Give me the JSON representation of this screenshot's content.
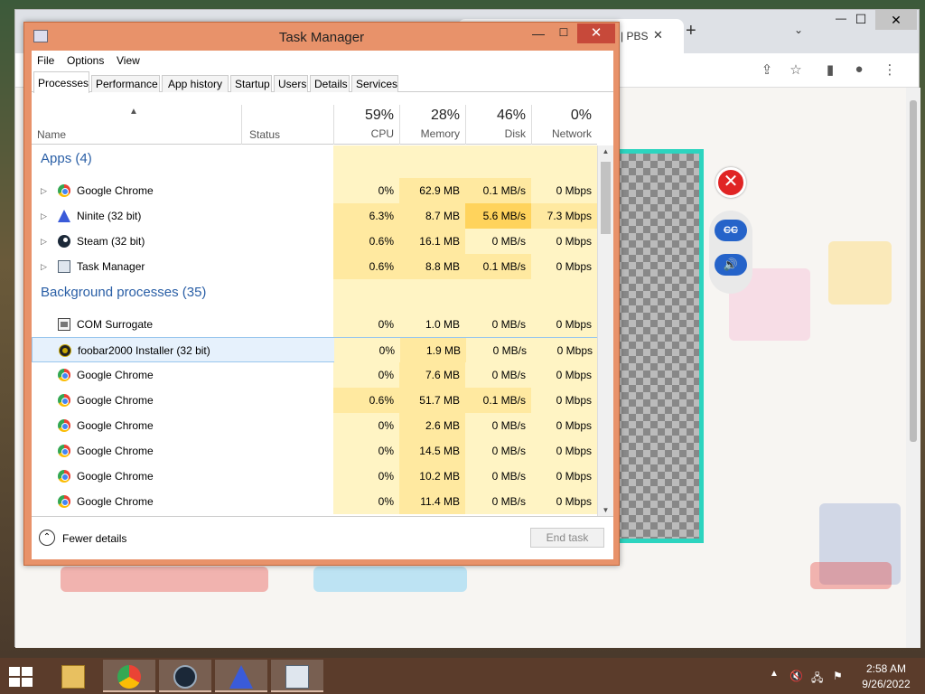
{
  "browser": {
    "tab_title": "| PBS",
    "tab_close": "✕",
    "new_tab": "+",
    "tab_search": "⌄",
    "minimize": "—",
    "maximize": "☐",
    "close": "✕",
    "icons": [
      "share-icon",
      "star-icon",
      "sidepanel-icon",
      "profile-icon",
      "menu-dots-icon"
    ]
  },
  "game": {
    "close": "✕",
    "cc": "CC",
    "sound": "🔊"
  },
  "task_manager": {
    "title": "Task Manager",
    "minimize": "—",
    "maximize": "☐",
    "close": "✕",
    "menu": [
      "File",
      "Options",
      "View"
    ],
    "tabs": [
      "Processes",
      "Performance",
      "App history",
      "Startup",
      "Users",
      "Details",
      "Services"
    ],
    "active_tab": "Processes",
    "columns": {
      "name": "Name",
      "status": "Status",
      "cpu": {
        "pct": "59%",
        "label": "CPU"
      },
      "memory": {
        "pct": "28%",
        "label": "Memory"
      },
      "disk": {
        "pct": "46%",
        "label": "Disk"
      },
      "network": {
        "pct": "0%",
        "label": "Network"
      }
    },
    "groups": {
      "apps": "Apps (4)",
      "background": "Background processes (35)"
    },
    "apps": [
      {
        "name": "Google Chrome",
        "icon": "chrome-icon",
        "cpu": "0%",
        "memory": "62.9 MB",
        "disk": "0.1 MB/s",
        "network": "0 Mbps"
      },
      {
        "name": "Ninite (32 bit)",
        "icon": "ninite-icon",
        "cpu": "6.3%",
        "memory": "8.7 MB",
        "disk": "5.6 MB/s",
        "network": "7.3 Mbps"
      },
      {
        "name": "Steam (32 bit)",
        "icon": "steam-icon",
        "cpu": "0.6%",
        "memory": "16.1 MB",
        "disk": "0 MB/s",
        "network": "0 Mbps"
      },
      {
        "name": "Task Manager",
        "icon": "task-manager-icon",
        "cpu": "0.6%",
        "memory": "8.8 MB",
        "disk": "0.1 MB/s",
        "network": "0 Mbps"
      }
    ],
    "background": [
      {
        "name": "COM Surrogate",
        "icon": "com-surrogate-icon",
        "cpu": "0%",
        "memory": "1.0 MB",
        "disk": "0 MB/s",
        "network": "0 Mbps"
      },
      {
        "name": "foobar2000 Installer (32 bit)",
        "icon": "foobar-icon",
        "cpu": "0%",
        "memory": "1.9 MB",
        "disk": "0 MB/s",
        "network": "0 Mbps"
      },
      {
        "name": "Google Chrome",
        "icon": "chrome-icon",
        "cpu": "0%",
        "memory": "7.6 MB",
        "disk": "0 MB/s",
        "network": "0 Mbps"
      },
      {
        "name": "Google Chrome",
        "icon": "chrome-icon",
        "cpu": "0.6%",
        "memory": "51.7 MB",
        "disk": "0.1 MB/s",
        "network": "0 Mbps"
      },
      {
        "name": "Google Chrome",
        "icon": "chrome-icon",
        "cpu": "0%",
        "memory": "2.6 MB",
        "disk": "0 MB/s",
        "network": "0 Mbps"
      },
      {
        "name": "Google Chrome",
        "icon": "chrome-icon",
        "cpu": "0%",
        "memory": "14.5 MB",
        "disk": "0 MB/s",
        "network": "0 Mbps"
      },
      {
        "name": "Google Chrome",
        "icon": "chrome-icon",
        "cpu": "0%",
        "memory": "10.2 MB",
        "disk": "0 MB/s",
        "network": "0 Mbps"
      },
      {
        "name": "Google Chrome",
        "icon": "chrome-icon",
        "cpu": "0%",
        "memory": "11.4 MB",
        "disk": "0 MB/s",
        "network": "0 Mbps"
      }
    ],
    "fewer_details": "Fewer details",
    "end_task": "End task"
  },
  "taskbar": {
    "pinned": [
      "file-explorer-icon",
      "chrome-icon",
      "steam-icon",
      "ninite-icon",
      "task-manager-icon"
    ],
    "time": "2:58 AM",
    "date": "9/26/2022"
  },
  "colors": {
    "window_frame": "#e8926a",
    "group_title": "#2a5fa6",
    "heat_low": "#fff4c4",
    "heat_mid": "#ffe9a0",
    "heat_high": "#ffd35c",
    "game_border": "#2dd4bf"
  }
}
